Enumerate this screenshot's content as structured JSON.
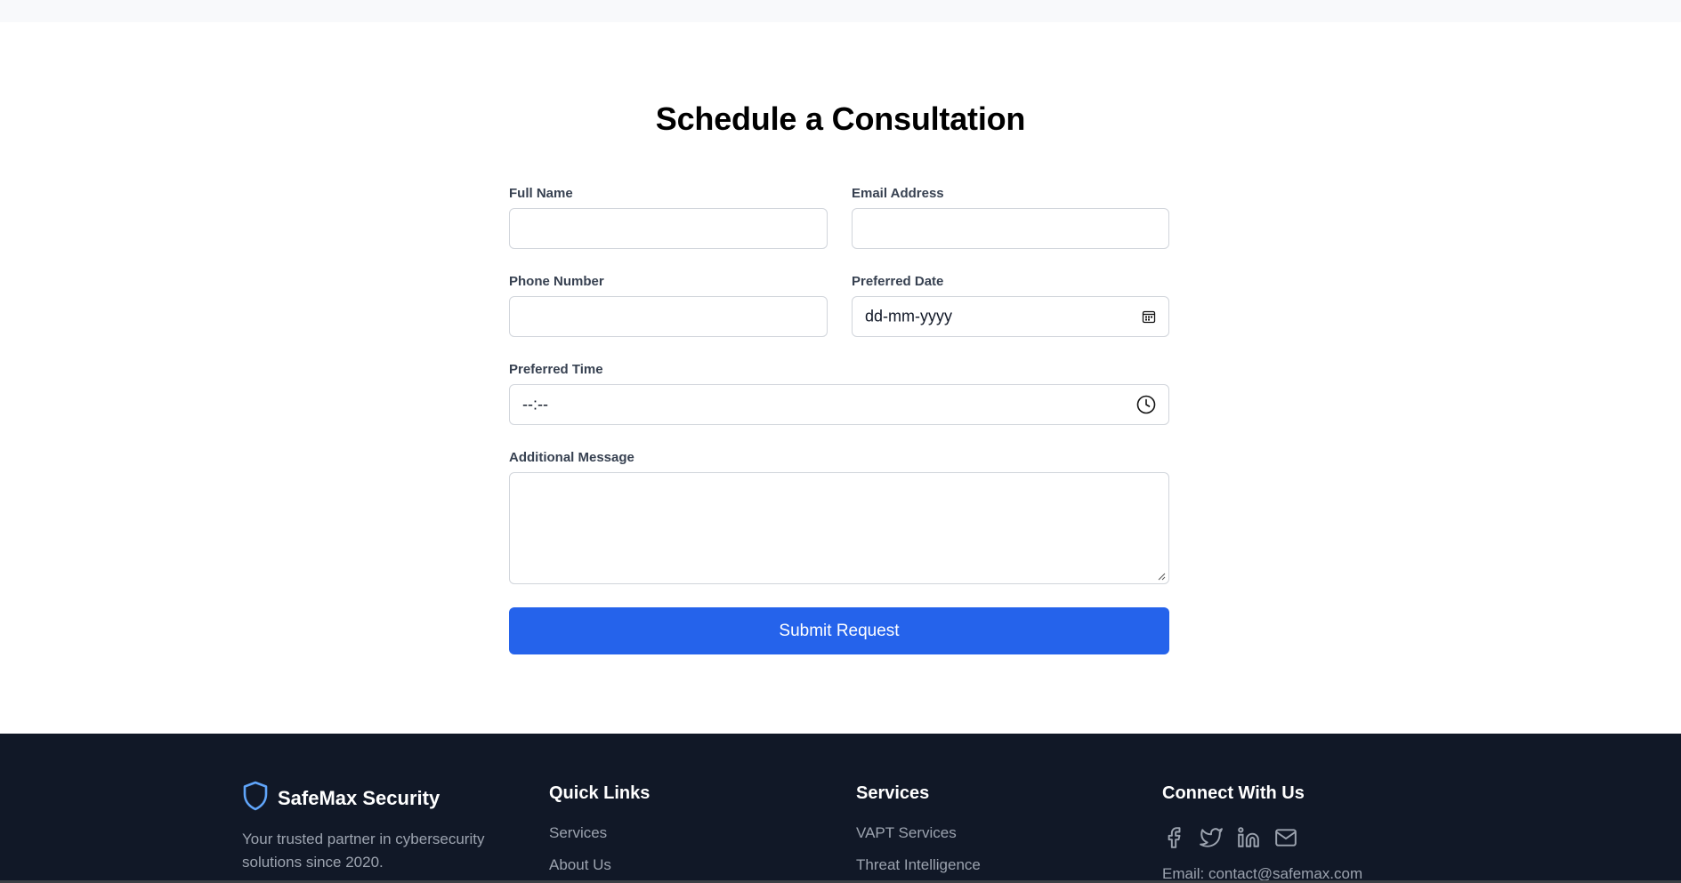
{
  "form": {
    "title": "Schedule a Consultation",
    "full_name": {
      "label": "Full Name",
      "value": ""
    },
    "email": {
      "label": "Email Address",
      "value": ""
    },
    "phone": {
      "label": "Phone Number",
      "value": ""
    },
    "date": {
      "label": "Preferred Date",
      "value": "dd-mm-yyyy",
      "icon": "calendar-icon"
    },
    "time": {
      "label": "Preferred Time",
      "value": "--:--",
      "icon": "clock-icon"
    },
    "message": {
      "label": "Additional Message",
      "value": ""
    },
    "submit_label": "Submit Request"
  },
  "footer": {
    "brand": {
      "name": "SafeMax Security",
      "icon": "shield-icon",
      "tagline": "Your trusted partner in cybersecurity solutions since 2020."
    },
    "quick_links": {
      "title": "Quick Links",
      "items": [
        "Services",
        "About Us"
      ]
    },
    "services": {
      "title": "Services",
      "items": [
        "VAPT Services",
        "Threat Intelligence"
      ]
    },
    "connect": {
      "title": "Connect With Us",
      "social_icons": [
        "facebook-icon",
        "twitter-icon",
        "linkedin-icon",
        "mail-icon"
      ],
      "email_text": "Email: contact@safemax.com"
    }
  },
  "colors": {
    "accent": "#2563eb",
    "footer_bg": "#111827",
    "brand_icon": "#60a5fa",
    "muted_text": "#9ca3af",
    "border": "#d1d5db"
  }
}
